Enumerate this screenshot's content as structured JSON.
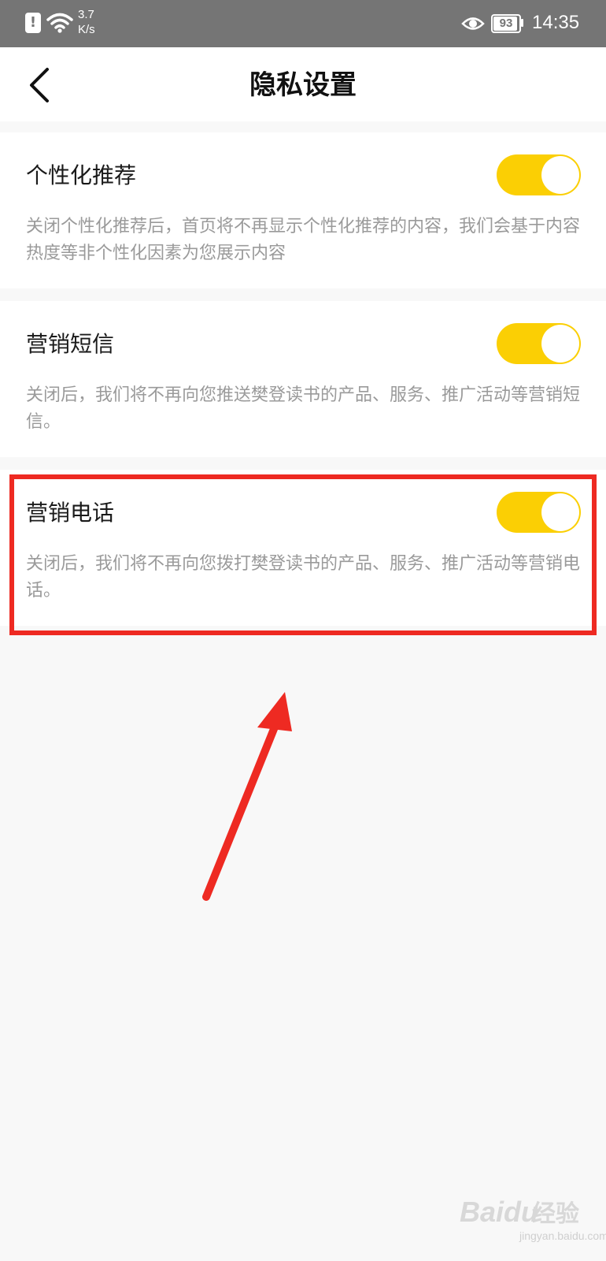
{
  "status_bar": {
    "network_speed_value": "3.7",
    "network_speed_unit": "K/s",
    "battery": "93",
    "time": "14:35"
  },
  "header": {
    "title": "隐私设置",
    "back_icon": "chevron-left-icon"
  },
  "settings": [
    {
      "title": "个性化推荐",
      "description": "关闭个性化推荐后，首页将不再显示个性化推荐的内容，我们会基于内容热度等非个性化因素为您展示内容",
      "enabled": true
    },
    {
      "title": "营销短信",
      "description": "关闭后，我们将不再向您推送樊登读书的产品、服务、推广活动等营销短信。",
      "enabled": true
    },
    {
      "title": "营销电话",
      "description": "关闭后，我们将不再向您拨打樊登读书的产品、服务、推广活动等营销电话。",
      "enabled": true,
      "highlighted": true
    }
  ],
  "watermark": {
    "logo": "Baidu",
    "label": "经验",
    "url": "jingyan.baidu.com"
  },
  "colors": {
    "toggle_on": "#fbcf04",
    "highlight": "#ee2a22",
    "status_bar": "#757575"
  }
}
